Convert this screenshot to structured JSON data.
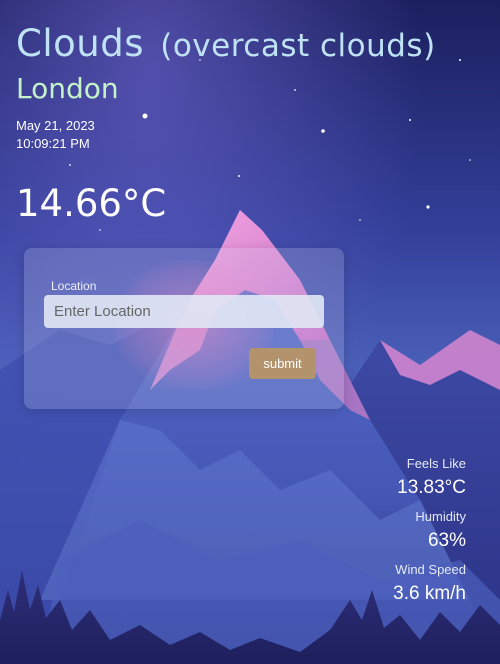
{
  "weather": {
    "condition": "Clouds",
    "description": "(overcast clouds)",
    "city": "London",
    "date": "May 21, 2023",
    "time": "10:09:21 PM",
    "temperature": "14.66°C"
  },
  "form": {
    "location_label": "Location",
    "location_placeholder": "Enter Location",
    "location_value": "",
    "submit_label": "submit"
  },
  "stats": [
    {
      "label": "Feels Like",
      "value": "13.83°C"
    },
    {
      "label": "Humidity",
      "value": "63%"
    },
    {
      "label": "Wind Speed",
      "value": "3.6 km/h"
    }
  ],
  "colors": {
    "condition_text": "#bfe3f5",
    "city_text": "#c4f2c9",
    "submit_button": "#b3936c",
    "sky_top": "#1c1f5e",
    "mountain_highlight": "#e48ad0"
  },
  "icons": {
    "background": "mountain-night-sky-illustration"
  }
}
